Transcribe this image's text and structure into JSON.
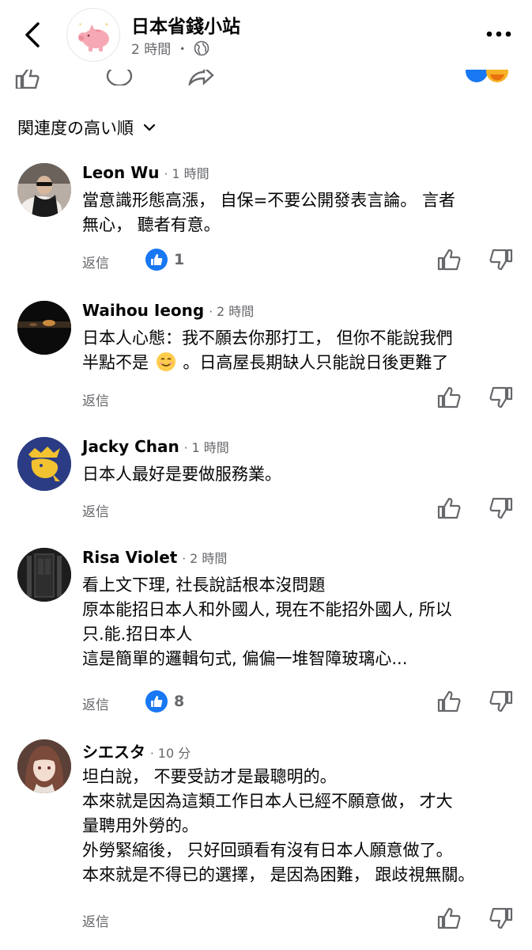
{
  "header": {
    "page_name": "日本省錢小站",
    "time": "2 時間",
    "dot": "・"
  },
  "sort": {
    "label": "関連度の高い順"
  },
  "comments": [
    {
      "name": "Leon Wu",
      "time": "1 時間",
      "lines": [
        "當意識形態高漲，  自保=不要公開發表言論。 言者",
        "無心， 聽者有意。"
      ],
      "reply": "返信",
      "likes": "1"
    },
    {
      "name": "Waihou Ieong",
      "time": "2 時間",
      "lines": [
        "日本人心態：我不願去你那打工， 但你不能說我們",
        "半點不是",
        "。日高屋長期缺人只能說日後更難了"
      ],
      "reply": "返信",
      "likes": ""
    },
    {
      "name": "Jacky Chan",
      "time": "1 時間",
      "lines": [
        "日本人最好是要做服務業。"
      ],
      "reply": "返信",
      "likes": ""
    },
    {
      "name": "Risa Violet",
      "time": "2 時間",
      "lines": [
        "看上文下理, 社長說話根本沒問題",
        "原本能招日本人和外國人, 現在不能招外國人, 所以",
        "只.能.招日本人",
        "這是簡單的邏輯句式, 偏偏一堆智障玻璃心..."
      ],
      "reply": "返信",
      "likes": "8"
    },
    {
      "name": "シエスタ",
      "time": "10 分",
      "lines": [
        "坦白說， 不要受訪才是最聰明的。",
        "本來就是因為這類工作日本人已經不願意做， 才大",
        "量聘用外勞的。",
        "外勞緊縮後， 只好回頭看有沒有日本人願意做了。",
        "本來就是不得已的選擇， 是因為困難， 跟歧視無關。"
      ],
      "reply": "返信",
      "likes": ""
    }
  ],
  "colors": {
    "text": "#050505",
    "secondary": "#65676b",
    "like_blue": "#1877f2"
  },
  "icons": [
    "back-chevron-icon",
    "piggy-bank-logo",
    "globe-icon",
    "more-icon",
    "like-icon",
    "comment-icon",
    "share-icon",
    "chevron-down-icon",
    "thumbs-up-icon",
    "thumbs-down-icon",
    "smile-emoji-icon"
  ]
}
